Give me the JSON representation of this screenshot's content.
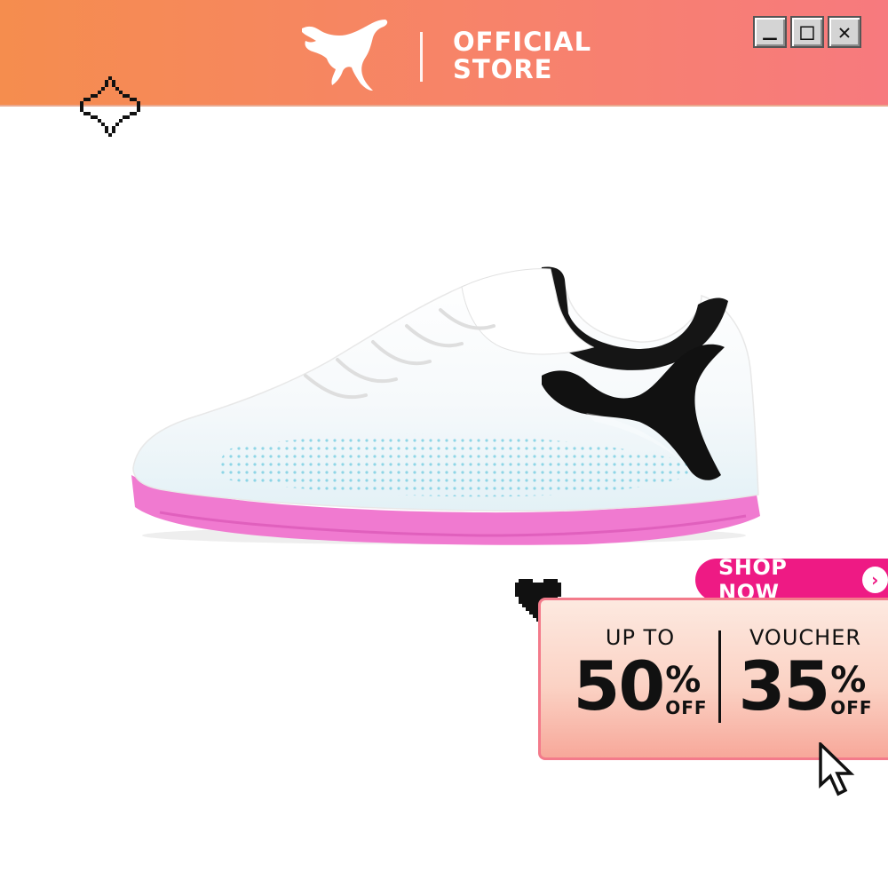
{
  "header": {
    "store_line1": "OFFICIAL",
    "store_line2": "STORE",
    "brand_icon": "puma-logo-icon"
  },
  "window_controls": {
    "minimize": "_",
    "maximize": "□",
    "close": "✕"
  },
  "promo": {
    "shop_now_label": "SHOP NOW",
    "shop_now_arrow": "›",
    "left": {
      "kicker": "UP TO",
      "value": "50",
      "percent": "%",
      "suffix": "OFF"
    },
    "right": {
      "kicker": "VOUCHER",
      "value": "35",
      "percent": "%",
      "suffix": "OFF"
    }
  },
  "colors": {
    "header_gradient_start": "#f58d4e",
    "header_gradient_end": "#f77a7e",
    "shop_now_pink": "#ee1a84",
    "sole_pink": "#f07ad0",
    "promo_border": "#f37b8b"
  },
  "icons": [
    "puma-logo-icon",
    "sparkle-icon",
    "heart-icon",
    "cursor-icon",
    "chevron-right-icon"
  ]
}
